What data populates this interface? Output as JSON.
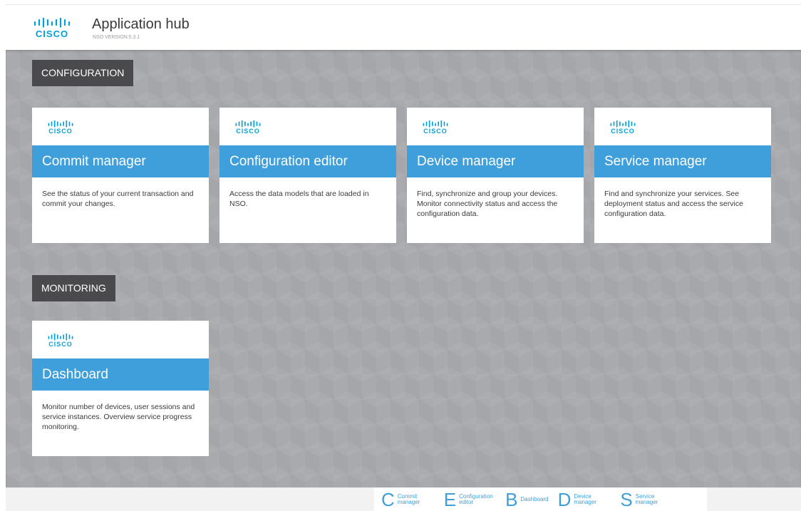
{
  "header": {
    "logo_word": "CISCO",
    "title": "Application hub",
    "version": "NSO VERSION:5.3.1"
  },
  "sections": {
    "configuration": "CONFIGURATION",
    "monitoring": "MONITORING"
  },
  "cards": [
    {
      "logo_word": "CISCO",
      "title": "Commit manager",
      "description": "See the status of your current transaction and commit your changes."
    },
    {
      "logo_word": "CISCO",
      "title": "Configuration editor",
      "description": "Access the data models that are loaded in NSO."
    },
    {
      "logo_word": "CISCO",
      "title": "Device manager",
      "description": "Find, synchronize and group your devices. Monitor connectivity status and access the configuration data."
    },
    {
      "logo_word": "CISCO",
      "title": "Service manager",
      "description": "Find and synchronize your services. See deployment status and access the service configuration data."
    },
    {
      "logo_word": "CISCO",
      "title": "Dashboard",
      "description": "Monitor number of devices, user sessions and service instances. Overview service progress monitoring."
    }
  ],
  "footer": {
    "links": [
      {
        "letter": "C",
        "label": "Commit manager"
      },
      {
        "letter": "E",
        "label": "Configuration editor"
      },
      {
        "letter": "B",
        "label": "Dashboard"
      },
      {
        "letter": "D",
        "label": "Device manager"
      },
      {
        "letter": "S",
        "label": "Service manager"
      }
    ]
  },
  "colors": {
    "accent": "#3f9fda",
    "cisco_blue": "#049fd9",
    "section_label_bg": "#4a4a4c",
    "background": "#a9aaae"
  },
  "icons": {
    "logo": "cisco-logo-icon"
  }
}
